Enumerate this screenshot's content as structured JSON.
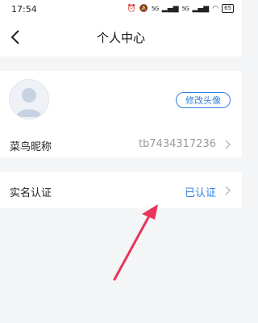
{
  "status_bar": {
    "time": "17:54",
    "signal_1": "5G",
    "signal_2": "5G",
    "battery": "65"
  },
  "nav": {
    "title": "个人中心"
  },
  "profile": {
    "change_avatar_label": "修改头像",
    "nickname_label": "菜鸟昵称",
    "nickname_value": "tb7434317236"
  },
  "verification": {
    "label": "实名认证",
    "status": "已认证"
  },
  "colors": {
    "accent": "#2f7fe0",
    "annotation": "#e8355a"
  }
}
